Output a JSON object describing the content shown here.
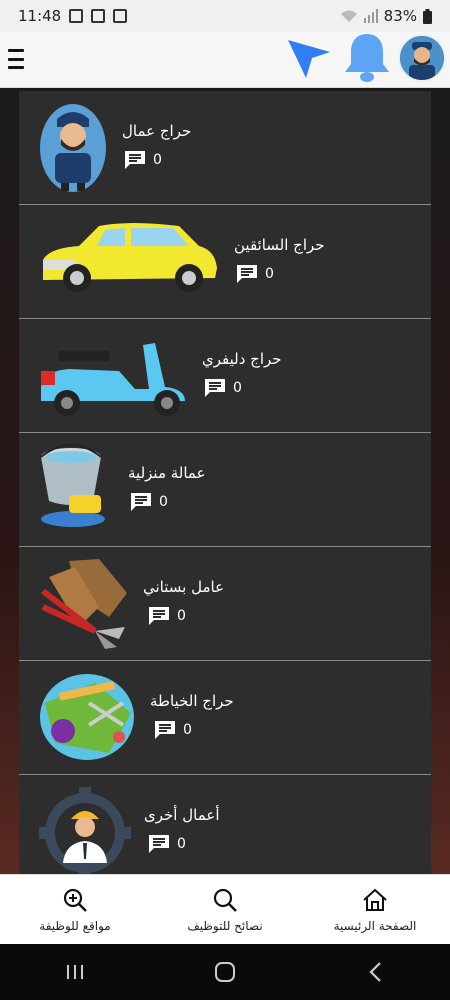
{
  "status_bar": {
    "time": "11:48",
    "battery": "83%"
  },
  "categories": [
    {
      "title": "حراج عمال",
      "count": "0",
      "image": "worker-mascot"
    },
    {
      "title": "حراج السائقين",
      "count": "0",
      "image": "yellow-car"
    },
    {
      "title": "حراج دليفري",
      "count": "0",
      "image": "scooter"
    },
    {
      "title": "عمالة منزلية",
      "count": "0",
      "image": "cleaning-bucket"
    },
    {
      "title": "عامل بستاني",
      "count": "0",
      "image": "garden-tools"
    },
    {
      "title": "حراج الخياطة",
      "count": "0",
      "image": "sewing-tools"
    },
    {
      "title": "أعمال أخرى",
      "count": "0",
      "image": "engineer-gear"
    }
  ],
  "bottom_nav": {
    "home": "الصفحة الرئيسية",
    "tips": "نصائح للتوظيف",
    "sites": "مواقع للوظيفة"
  },
  "colors": {
    "card_bg": "#2d2d2d",
    "accent_blue": "#3d8ef0"
  }
}
